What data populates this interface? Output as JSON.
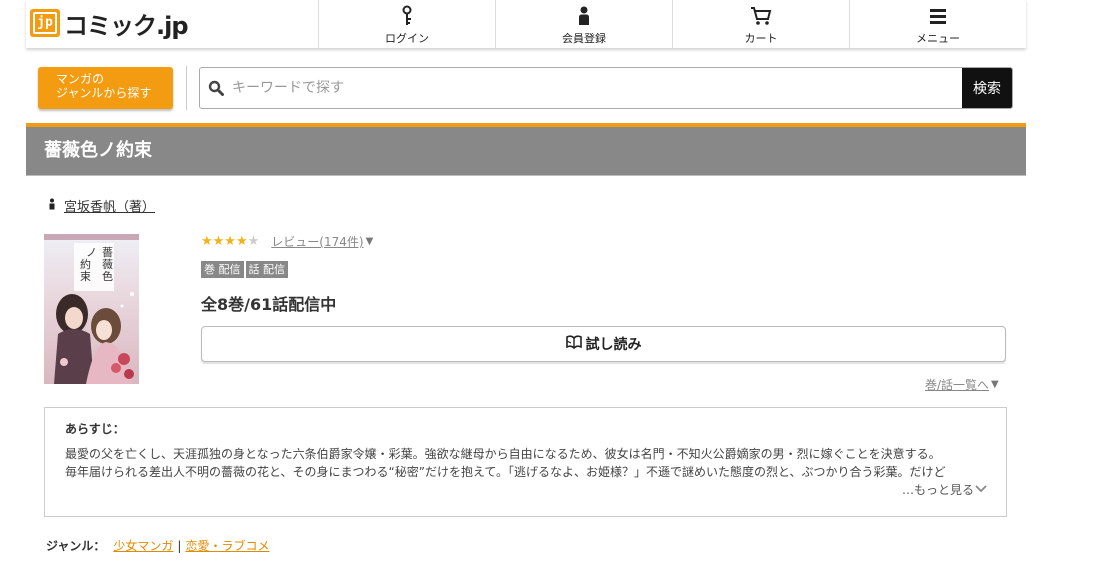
{
  "header": {
    "logo_text": "コミック.jp",
    "logo_mark": "jp",
    "nav": [
      {
        "label": "ログイン",
        "icon": "key-icon"
      },
      {
        "label": "会員登録",
        "icon": "person-icon"
      },
      {
        "label": "カート",
        "icon": "cart-icon"
      },
      {
        "label": "メニュー",
        "icon": "menu-icon"
      }
    ]
  },
  "search": {
    "genre_button_line1": "マンガの",
    "genre_button_line2": "ジャンルから探す",
    "placeholder": "キーワードで探す",
    "button": "検索"
  },
  "book": {
    "title": "薔薇色ノ約束",
    "author": "宮坂香帆（著）",
    "rating_stars": 4,
    "review_link": "レビュー(174件)",
    "badges": [
      "巻 配信",
      "話 配信"
    ],
    "count": "全8巻/61話配信中",
    "trial_button": "試し読み",
    "volume_link": "巻/話一覧へ"
  },
  "synopsis": {
    "title": "あらすじ：",
    "line1": "最愛の父を亡くし、天涯孤独の身となった六条伯爵家令嬢・彩葉。強欲な継母から自由になるため、彼女は名門・不知火公爵嫡家の男・烈に嫁ぐことを決意する。",
    "line2": "毎年届けられる差出人不明の薔薇の花と、その身にまつわる“秘密”だけを抱えて。「逃げるなよ、お姫様？」不遜で謎めいた態度の烈と、ぶつかり合う彩葉。だけど",
    "more": "…もっと見る"
  },
  "genre": {
    "label": "ジャンル：",
    "items": [
      "少女マンガ",
      "恋愛・ラブコメ"
    ],
    "separator": "|"
  },
  "colors": {
    "accent": "#f39c12",
    "title_bar": "#888888",
    "star": "#f5b01a"
  }
}
